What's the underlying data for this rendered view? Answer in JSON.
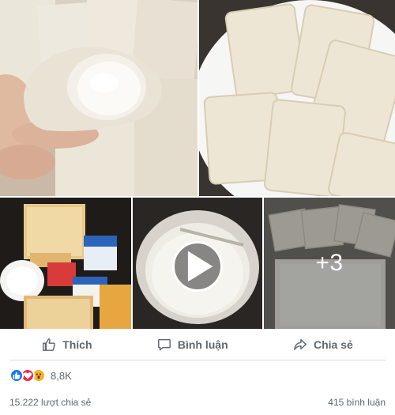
{
  "photos": {
    "more_count": "+3"
  },
  "actions": {
    "like_label": "Thích",
    "comment_label": "Bình luận",
    "share_label": "Chia sẻ"
  },
  "reactions": {
    "icons": [
      "like-icon",
      "love-icon",
      "wow-icon"
    ],
    "count": "8,8K"
  },
  "stats": {
    "shares": "15.222 lượt chia sẻ",
    "comments": "415 bình luận"
  },
  "colors": {
    "action_text": "#606770",
    "like_blue": "#1877f2",
    "love_red": "#f0284a",
    "wow_yellow": "#f7b125"
  }
}
